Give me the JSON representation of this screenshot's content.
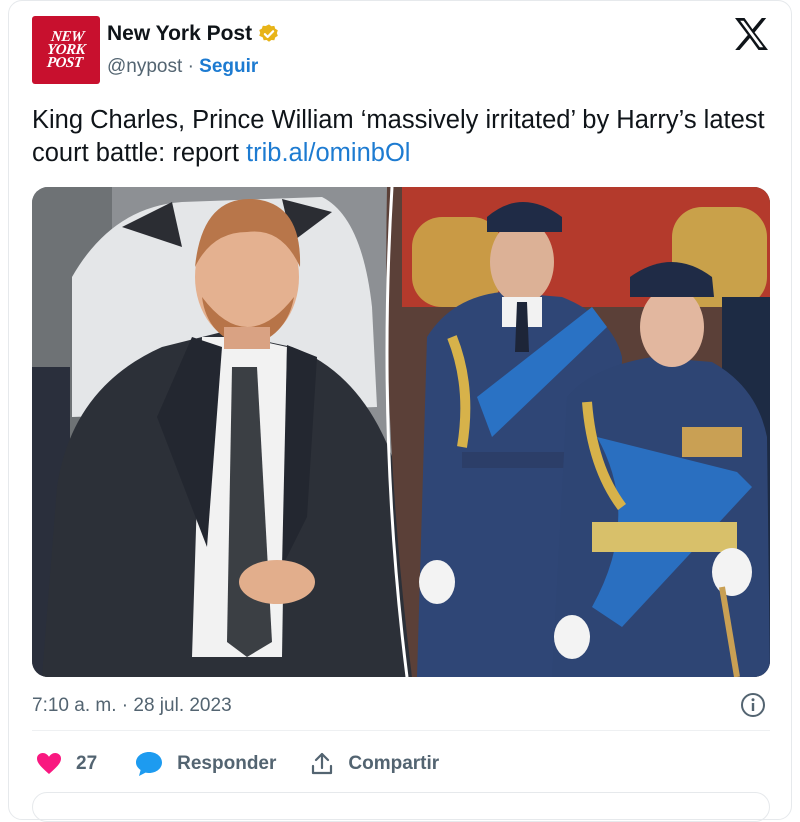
{
  "account": {
    "name": "New York Post",
    "logo_text": [
      "NEW",
      "YORK",
      "POST"
    ],
    "handle": "@nypost",
    "separator": "·",
    "follow_label": "Seguir",
    "verified_color": "#e8b418"
  },
  "tweet": {
    "text": "King Charles, Prince William ‘massively irritated’ by Harry’s latest court battle: report",
    "link": "trib.al/ominbOl",
    "time": "7:10 a. m.",
    "date": "28 jul. 2023"
  },
  "actions": {
    "likes": "27",
    "reply_label": "Responder",
    "share_label": "Compartir"
  },
  "icons": {
    "close": "x-logo-icon",
    "info": "info-icon",
    "like": "heart-icon",
    "reply": "speech-bubble-icon",
    "share": "share-upload-icon"
  },
  "colors": {
    "brand_red": "#c8102e",
    "link_blue": "#1d7bd1",
    "heart": "#f91880",
    "reply": "#1d9bf0",
    "muted": "#536471"
  }
}
